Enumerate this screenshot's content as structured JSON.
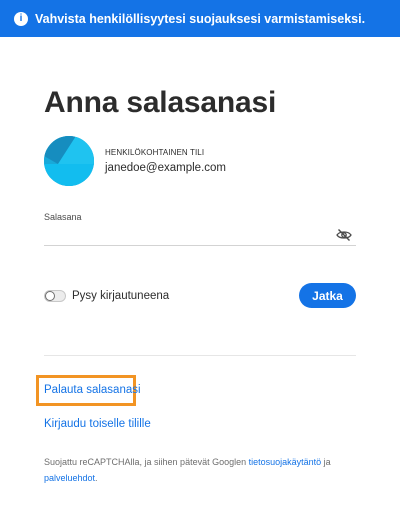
{
  "banner": {
    "icon": "info-icon",
    "icon_glyph": "i",
    "text": "Vahvista henkilöllisyytesi suojauksesi varmistamiseksi."
  },
  "page": {
    "title": "Anna salasanasi"
  },
  "account": {
    "type_label": "HENKILÖKOHTAINEN TILI",
    "email": "janedoe@example.com"
  },
  "password": {
    "label": "Salasana",
    "value": "",
    "visibility_icon": "eye-slash-icon"
  },
  "stay_signed_in": {
    "label": "Pysy kirjautuneena",
    "checked": false
  },
  "continue_button": {
    "label": "Jatka"
  },
  "links": {
    "reset_password": "Palauta salasanasi",
    "other_account": "Kirjaudu toiselle tilille"
  },
  "recaptcha": {
    "prefix": "Suojattu reCAPTCHAlla, ja siihen pätevät Googlen ",
    "privacy_link": "tietosuojakäytäntö",
    "middle": " ja ",
    "terms_link": "palveluehdot",
    "suffix": "."
  },
  "colors": {
    "accent": "#1473e6",
    "highlight": "#f29423",
    "avatar": "#19a9d9"
  }
}
